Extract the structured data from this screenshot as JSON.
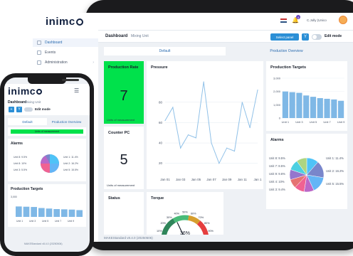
{
  "brand": {
    "logo_text": "inimc",
    "logo_o": "o"
  },
  "sidebar": {
    "items": [
      {
        "label": "Dashboard",
        "active": true
      },
      {
        "label": "Events",
        "active": false
      },
      {
        "label": "Administration",
        "active": false
      }
    ]
  },
  "topbar": {
    "user": "C.Jolly (Unico",
    "notification_count": "4"
  },
  "header": {
    "title": "Dashboard",
    "subtitle": "Mixing Unit",
    "select_label": "Select panel",
    "filter_icon": "Y",
    "edit_label": "Edit mode"
  },
  "tabs": [
    {
      "label": "Default",
      "active": true
    },
    {
      "label": "Production Overview",
      "active": false
    }
  ],
  "widgets": {
    "production_rate": {
      "title": "Production Rate",
      "value": "7",
      "unit": "Units of measurement"
    },
    "counter": {
      "title": "Counter PC",
      "value": "5",
      "unit": "Units of measurement"
    },
    "status": {
      "title": "Status"
    },
    "torque": {
      "title": "Torque",
      "ticks": [
        "10%",
        "20%",
        "30%",
        "40%",
        "50%",
        "60%",
        "70%",
        "80%",
        "90%"
      ],
      "value_label": "36%"
    },
    "pressure": {
      "title": "Pressure"
    },
    "production_targets": {
      "title": "Production Targets"
    },
    "alarms": {
      "title": "Alarms"
    }
  },
  "footer": {
    "text": "MAKEStandard v8.4.0 (20250506)"
  },
  "phone": {
    "dashboard": "Dashboard",
    "subtitle": "Mixing Unit",
    "edit_label": "Edit mode",
    "tabs": [
      "Default",
      "Production Overview"
    ],
    "green_label": "Units of measurement",
    "alarms_title": "Alarms",
    "alarm_labels_left": [
      "Unit 8: 9.5%",
      "Unit 8: 10%",
      "Unit 3: 5.5%"
    ],
    "alarm_labels_right": [
      "Unit 1: 11.4%",
      "Unit 2: 16.2%",
      "Unit 5: 15.5%"
    ],
    "targets_title": "Production Targets",
    "targets_axis": [
      "Unit 1",
      "Unit 3",
      "Unit 5",
      "Unit 7",
      "Unit 9"
    ],
    "targets_ytick": "3,000",
    "footer": "MAKEStandard v8.4.0 (20250506)"
  },
  "chart_data": [
    {
      "type": "line",
      "title": "Pressure",
      "x": [
        "Jan 01",
        "Jan 03",
        "Jan 05",
        "Jan 07",
        "Jan 09",
        "Jan 11",
        "Jan 1"
      ],
      "series": [
        {
          "values": [
            62,
            75,
            35,
            48,
            45,
            100,
            40,
            20,
            35,
            32,
            80,
            55,
            92
          ]
        }
      ],
      "yticks": [
        "20",
        "40",
        "60",
        "80"
      ],
      "ylim": [
        10,
        105
      ],
      "color": "#90c1e8"
    },
    {
      "type": "bar",
      "title": "Production Targets",
      "categories": [
        "Unit 1",
        "Unit 2",
        "Unit 3",
        "Unit 4",
        "Unit 5",
        "Unit 6",
        "Unit 7",
        "Unit 8",
        "Unit 9"
      ],
      "values": [
        2000,
        1950,
        1900,
        1700,
        1600,
        1500,
        1450,
        1400,
        1300
      ],
      "xticks": [
        "Unit 1",
        "Unit 3",
        "Unit 5",
        "Unit 7",
        "Unit 9"
      ],
      "yticks": [
        "0",
        "1,000",
        "2,000",
        "3,000"
      ],
      "ylim": [
        0,
        3000
      ],
      "color": "#7fb8e6"
    },
    {
      "type": "pie",
      "title": "Alarms",
      "slices": [
        {
          "label": "Unit 1: 11.4%",
          "value": 11.4,
          "color": "#4fc3f7"
        },
        {
          "label": "Unit 2: 16.2%",
          "value": 16.2,
          "color": "#7986cb"
        },
        {
          "label": "Unit 5: 15.5%",
          "value": 15.5,
          "color": "#64b5f6"
        },
        {
          "label": "Unit 3: 9.4%",
          "value": 9.4,
          "color": "#ba68c8"
        },
        {
          "label": "Unit 8: 9.5%",
          "value": 9.5,
          "color": "#f06292"
        },
        {
          "label": "Unit 7: 8.5%",
          "value": 8.5,
          "color": "#e57373"
        },
        {
          "label": "Unit 9: 9.6%",
          "value": 9.6,
          "color": "#9575cd"
        },
        {
          "label": "Unit 4: 10%",
          "value": 10,
          "color": "#4dd0e1"
        },
        {
          "label": "Unit 6: 9.9%",
          "value": 9.9,
          "color": "#aed581"
        }
      ],
      "labels_left": [
        "Unit 8: 9.5%",
        "Unit 7: 8.5%",
        "Unit 9: 9.6%",
        "Unit 4: 10%",
        "Unit 3: 9.4%"
      ],
      "labels_right": [
        "Unit 1: 11.4%",
        "Unit 2: 16.2%",
        "Unit 5: 15.5%"
      ]
    }
  ]
}
